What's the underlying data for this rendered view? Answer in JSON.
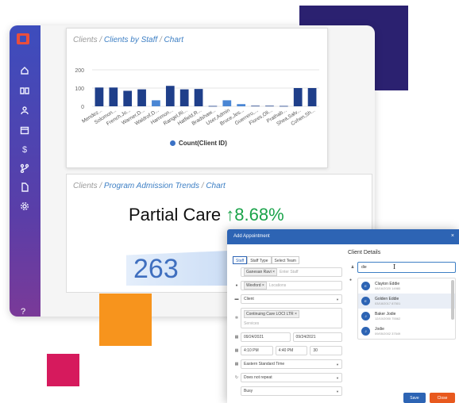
{
  "sidebar": {
    "icons": [
      "home-icon",
      "book-icon",
      "user-icon",
      "calendar-icon",
      "dollar-icon",
      "flow-icon",
      "document-icon",
      "settings-icon"
    ],
    "help": "?"
  },
  "card1": {
    "crumb_root": "Clients",
    "crumb_mid": "Clients by Staff",
    "crumb_end": "Chart"
  },
  "chart_data": {
    "type": "bar",
    "categories": [
      "Mendez...",
      "Solomon...",
      "French,Jo...",
      "Warner,D...",
      "Waldrof,D...",
      "Hammon...",
      "Rangel,Ri...",
      "Hatfield,R...",
      "Bradshaw...",
      "User,Admin",
      "Bruce,Jes...",
      "Guerrero,...",
      "Flores,Oli...",
      "Prathab...",
      "Shea,Salv...",
      "Cohen,Sh..."
    ],
    "values": [
      103,
      103,
      85,
      93,
      33,
      112,
      93,
      95,
      2,
      33,
      12,
      3,
      3,
      2,
      100,
      100
    ],
    "ylim": [
      0,
      200
    ],
    "yticks": [
      "200",
      "100",
      "0"
    ],
    "series": [
      {
        "name": "Count(Client ID)",
        "color": "#1f3f8a"
      }
    ],
    "highlight_color": "#4a86d4",
    "legend_position": "bottom",
    "grid": true
  },
  "card2": {
    "crumb_root": "Clients",
    "crumb_mid": "Program Admission Trends",
    "crumb_end": "Chart",
    "title": "Partial Care",
    "change": "↑8.68%",
    "big_number": "263"
  },
  "modal": {
    "title": "Add Appointment",
    "close": "×",
    "tabs": [
      "Staff",
      "Staff Type",
      "Select Team"
    ],
    "staff_chip": "Ganesan Ravi ×",
    "staff_placeholder": "Enter Staff",
    "location_chip": "Wexford ×",
    "location_placeholder": "Locations",
    "client_select": "Client",
    "service_chip": "Continuing Care LOCI LTR ×",
    "service_placeholder": "Services",
    "date_start": "09/24/2021",
    "date_end": "09/24/2021",
    "time_start": "4:10 PM",
    "time_end": "4:40 PM",
    "duration": "30",
    "timezone": "Eastern Standard Time",
    "repeat": "Does not repeat",
    "status": "Busy",
    "client_details_title": "Client Details",
    "search_value": "die",
    "results": [
      {
        "initial": "E",
        "name": "Clayton Eddie",
        "sub": "08/16/2020 14980"
      },
      {
        "initial": "E",
        "name": "Golden Eddie",
        "sub": "03/18/2017 87501"
      },
      {
        "initial": "J",
        "name": "Baker Jodie",
        "sub": "12/10/2000 75562"
      },
      {
        "initial": "J",
        "name": "Jodie",
        "sub": "09/05/2002 37549"
      }
    ],
    "save": "Save",
    "close_button": "Close"
  }
}
